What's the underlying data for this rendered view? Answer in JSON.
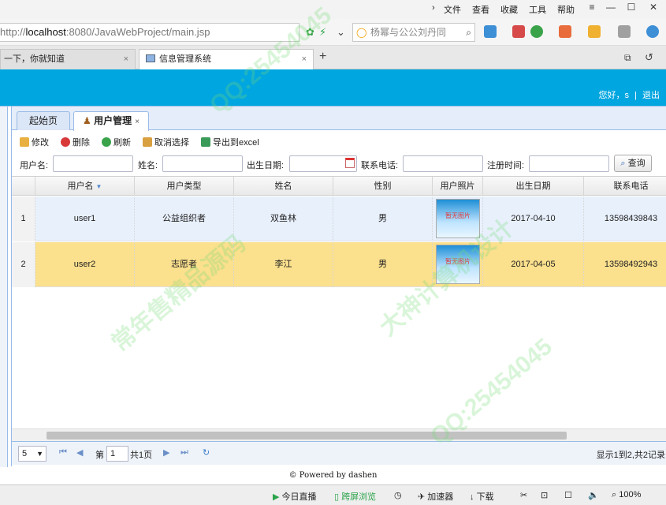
{
  "browser": {
    "menu": [
      "文件",
      "查看",
      "收藏",
      "工具",
      "帮助"
    ],
    "url_prefix": "http://",
    "url_host": "localhost",
    "url_rest": ":8080/JavaWebProject/main.jsp",
    "search_text": "杨幂与公公刘丹同",
    "tabs": [
      {
        "label": "一下，你就知道"
      },
      {
        "label": "信息管理系统"
      }
    ],
    "new_tab": "+"
  },
  "header": {
    "greeting": "您好，s",
    "logout": "退出"
  },
  "panel_tabs": [
    {
      "label": "起始页"
    },
    {
      "label": "用户管理",
      "close": "×"
    }
  ],
  "toolbar": {
    "edit": "修改",
    "delete": "删除",
    "refresh": "刷新",
    "cancel_select": "取消选择",
    "export": "导出到excel"
  },
  "filters": {
    "username_label": "用户名:",
    "name_label": "姓名:",
    "birth_label": "出生日期:",
    "phone_label": "联系电话:",
    "regtime_label": "注册时间:",
    "query_button": "查询"
  },
  "grid": {
    "columns": [
      "用户名",
      "用户类型",
      "姓名",
      "性别",
      "用户照片",
      "出生日期",
      "联系电话"
    ],
    "rows": [
      {
        "num": "1",
        "username": "user1",
        "type": "公益组织者",
        "name": "双鱼林",
        "gender": "男",
        "photo": "暂无图片",
        "birth": "2017-04-10",
        "phone": "13598439843"
      },
      {
        "num": "2",
        "username": "user2",
        "type": "志愿者",
        "name": "李江",
        "gender": "男",
        "photo": "暂无图片",
        "birth": "2017-04-05",
        "phone": "13598492943"
      }
    ]
  },
  "pager": {
    "page_size": "5",
    "page_label": "第",
    "page_value": "1",
    "total_pages": "共1页",
    "summary": "显示1到2,共2记录"
  },
  "footer": "Powered by dashen",
  "statusbar": {
    "live": "今日直播",
    "split": "跨屏浏览",
    "accelerator": "加速器",
    "download": "下载",
    "zoom": "100%"
  },
  "watermarks": [
    "QQ:25454045",
    "常年售精品源码",
    "大神计算机设计"
  ],
  "colors": {
    "header": "#00a6e0",
    "selected_row": "#fbe08d",
    "odd_row": "#e8f0fc",
    "accent": "#99bbe8"
  }
}
